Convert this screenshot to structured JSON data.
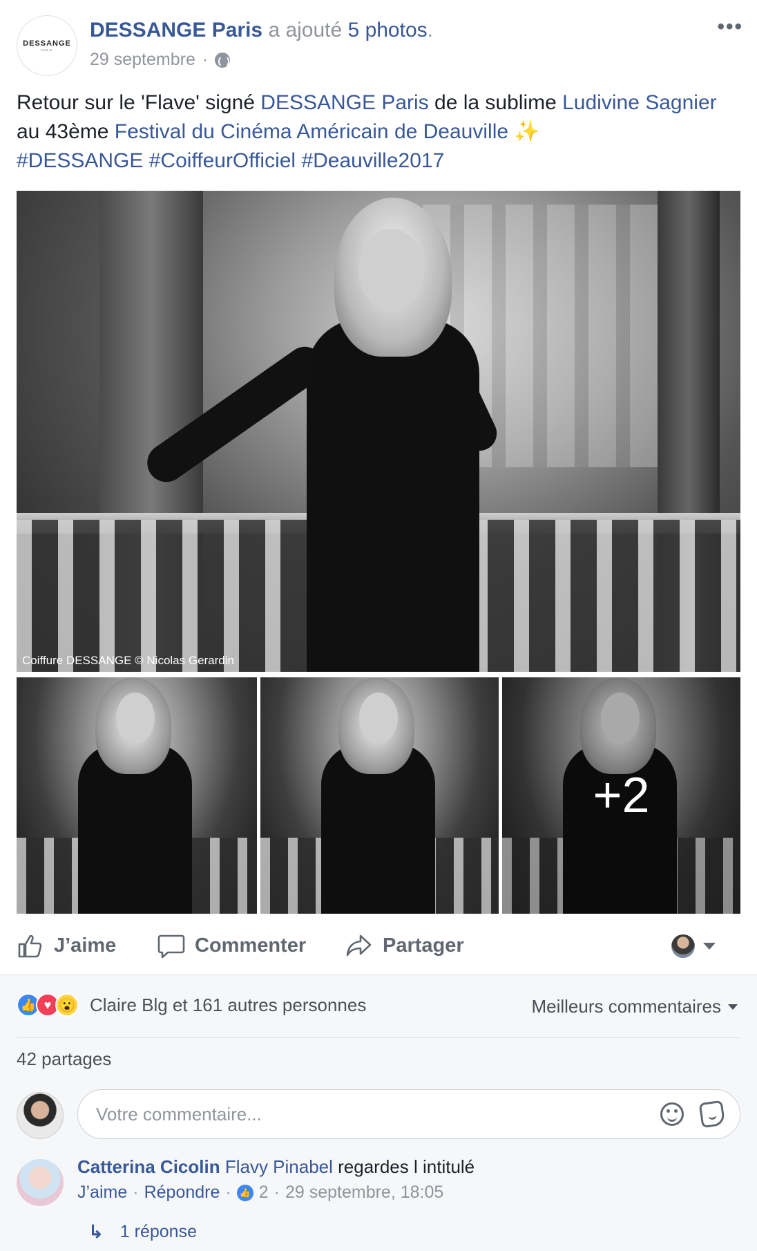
{
  "post": {
    "avatar_text": "DESSANGE",
    "avatar_sub": "PARIS",
    "page_name": "DESSANGE Paris",
    "verb": "a ajouté",
    "photos_link": "5 photos",
    "period": ".",
    "date": "29 septembre",
    "dot": "·",
    "more": "•••",
    "text": {
      "t1": "Retour sur le 'Flave' signé ",
      "l1": "DESSANGE Paris",
      "t2": " de la sublime ",
      "l2": "Ludivine Sagnier",
      "t3": " au 43ème ",
      "l3": "Festival du Cinéma Américain de Deauville",
      "sparkle": "✨",
      "h1": "#DESSANGE",
      "h2": "#CoiffeurOfficiel",
      "h3": "#Deauville2017"
    },
    "photo_credit": "Coiffure DESSANGE © Nicolas Gerardin",
    "more_photos": "+2"
  },
  "actions": {
    "like": "J’aime",
    "comment": "Commenter",
    "share": "Partager"
  },
  "feedback": {
    "reactions_text": "Claire Blg et 161 autres personnes",
    "best_comments": "Meilleurs commentaires",
    "shares": "42 partages",
    "comment_placeholder": "Votre commentaire..."
  },
  "comments": [
    {
      "author": "Catterina Cicolin",
      "tag": "Flavy Pinabel",
      "text": "regardes l intitulé",
      "like": "J’aime",
      "reply": "Répondre",
      "likes_count": "2",
      "time": "29 septembre, 18:05",
      "replies": "1 réponse"
    }
  ],
  "colors": {
    "link": "#385898",
    "meta": "#90949c",
    "action": "#606770",
    "like_blue": "#3b88f5",
    "love_red": "#f33e58",
    "wow_yellow": "#fcd341"
  }
}
